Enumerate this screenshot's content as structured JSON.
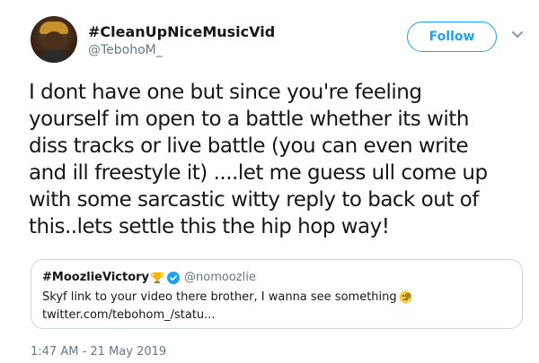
{
  "author": {
    "display_name": "#CleanUpNiceMusicVid",
    "handle": "@TebohoM_"
  },
  "follow_button": {
    "label": "Follow"
  },
  "icons": {
    "more": "chevron-down-icon",
    "trophy": "trophy-icon",
    "verified": "verified-badge-icon",
    "emoji": "face-with-monocle-emoji"
  },
  "colors": {
    "accent": "#1da1f2",
    "text": "#14171a",
    "muted": "#657786",
    "border": "#ccd6dd"
  },
  "tweet": {
    "lines": [
      "I dont have one but since you're feeling",
      "yourself im open to a battle whether its with",
      "diss tracks or live battle (you can even write",
      "and ill freestyle it) ....let me guess ull come up",
      "with some sarcastic witty reply to back out of",
      "this..lets settle this the hip hop way!"
    ],
    "timestamp": "1:47 AM - 21 May 2019"
  },
  "quoted_tweet": {
    "display_name": "#MoozlieVictory",
    "handle": "@nomoozlie",
    "text": "Skyf link to your video there brother, I wanna see something",
    "link": "twitter.com/tebohom_/statu..."
  }
}
